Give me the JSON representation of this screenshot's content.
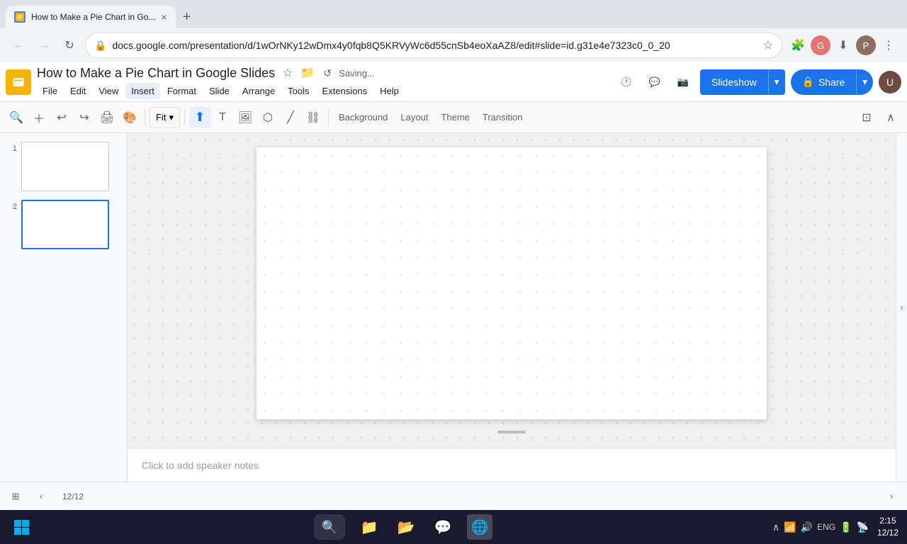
{
  "browser": {
    "tab": {
      "title": "How to Make a Pie Chart in Go...",
      "close_label": "×",
      "new_tab_label": "+"
    },
    "address": "docs.google.com/presentation/d/1wOrNKy12wDmx4y0fqb8Q5KRVyWc6d55cnSb4eoXaAZ8/edit#slide=id.g31e4e7323c0_0_20",
    "nav": {
      "back_disabled": true,
      "forward_disabled": true
    }
  },
  "app": {
    "logo_color": "#f4b400",
    "title": "How to Make a Pie Chart in Google Slides",
    "saving_text": "Saving...",
    "menu_items": [
      "File",
      "Edit",
      "View",
      "Insert",
      "Format",
      "Slide",
      "Arrange",
      "Tools",
      "Extensions",
      "Help"
    ],
    "active_menu": "Insert",
    "slideshow_label": "Slideshow",
    "share_label": "Share",
    "toolbar": {
      "zoom_label": "Fit",
      "background_label": "Background",
      "layout_label": "Layout",
      "theme_label": "Theme",
      "transition_label": "Transition"
    }
  },
  "slides": [
    {
      "number": "1",
      "selected": false
    },
    {
      "number": "2",
      "selected": true
    }
  ],
  "notes": {
    "placeholder": "Click to add speaker notes"
  },
  "slide_count": "12/12",
  "taskbar": {
    "icons": [
      "⊞",
      "🔍",
      "📁",
      "📂",
      "💬",
      "🌐"
    ],
    "sys_tray": {
      "time": "2:15",
      "date": "12/12",
      "lang": "ENG"
    }
  }
}
